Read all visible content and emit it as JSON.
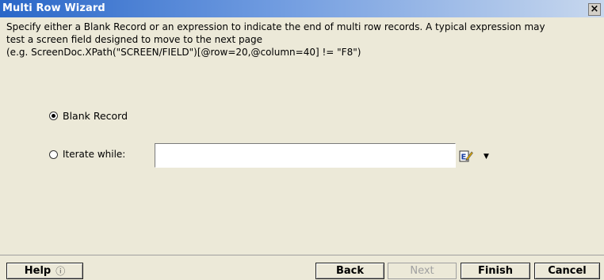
{
  "window": {
    "title": "Multi Row Wizard",
    "close_label": "×"
  },
  "description": {
    "line1": "Specify either a Blank Record or an expression to indicate the end of multi row records. A typical expression may",
    "line2": "test a screen field designed to move to the next page",
    "line3": "(e.g. ScreenDoc.XPath(\"SCREEN/FIELD\")[@row=20,@column=40] != \"F8\")"
  },
  "options": {
    "blank_record_label": "Blank Record",
    "blank_record_selected": true,
    "iterate_label": "Iterate while:",
    "iterate_selected": false,
    "iterate_value": ""
  },
  "icons": {
    "expression_editor": "expression-editor-icon",
    "dropdown": "chevron-down-icon",
    "help": "help-circle-icon"
  },
  "buttons": {
    "help": "Help",
    "help_icon": "?",
    "back": "Back",
    "next": "Next",
    "finish": "Finish",
    "cancel": "Cancel"
  },
  "colors": {
    "title_start": "#2a67c8",
    "title_end": "#c8d8ee",
    "dialog_bg": "#ece9d8"
  }
}
